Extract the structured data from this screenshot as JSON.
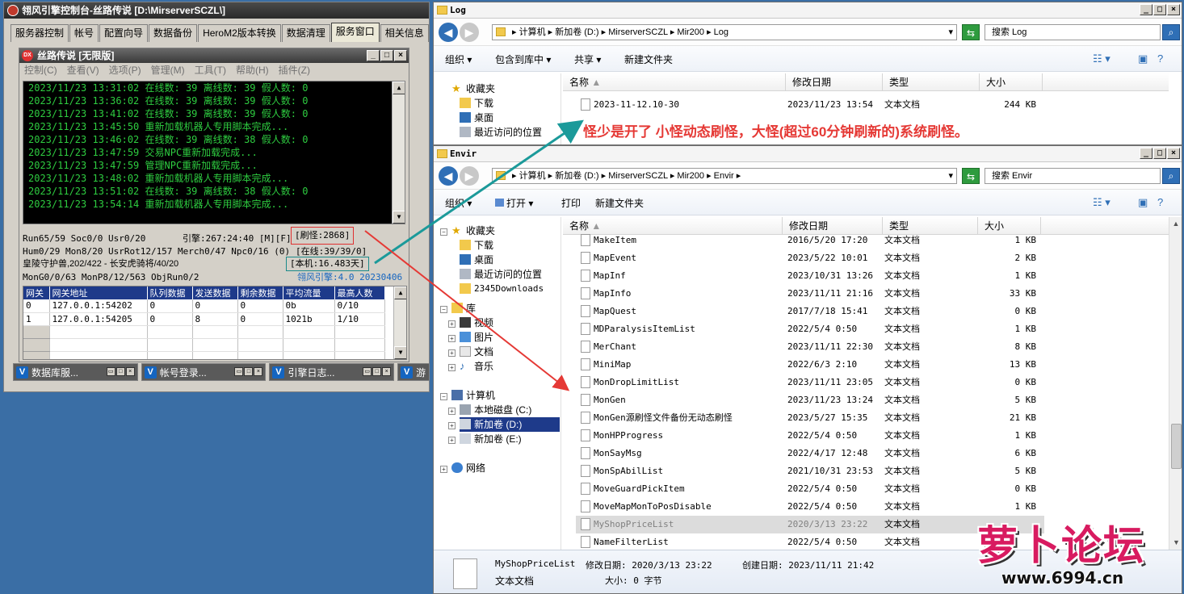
{
  "engine": {
    "title": "翎风引擎控制台-丝路传说 [D:\\MirserverSCZL\\]",
    "tabs": [
      "服务器控制",
      "帐号",
      "配置向导",
      "数据备份",
      "HeroM2版本转换",
      "数据清理",
      "服务窗口",
      "相关信息"
    ],
    "active_tab": 6,
    "child": {
      "title": "丝路传说 [无限版]",
      "logo_text": "DX",
      "menu": [
        "控制(C)",
        "查看(V)",
        "选项(P)",
        "管理(M)",
        "工具(T)",
        "帮助(H)",
        "插件(Z)"
      ],
      "log_lines": [
        "2023/11/23 13:31:02 在线数: 39 离线数: 39 假人数: 0",
        "2023/11/23 13:36:02 在线数: 39 离线数: 39 假人数: 0",
        "2023/11/23 13:41:02 在线数: 39 离线数: 39 假人数: 0",
        "2023/11/23 13:45:50 重新加载机器人专用脚本完成...",
        "2023/11/23 13:46:02 在线数: 39 离线数: 38 假人数: 0",
        "2023/11/23 13:47:59 交易NPC重新加载完成...",
        "2023/11/23 13:47:59 管理NPC重新加载完成...",
        "2023/11/23 13:48:02 重新加载机器人专用脚本完成...",
        "2023/11/23 13:51:02 在线数: 39 离线数: 38 假人数: 0",
        "2023/11/23 13:54:14 重新加载机器人专用脚本完成..."
      ],
      "status": {
        "run": "Run65/59 Soc0/0 Usr0/20",
        "engine_time": "引擎:267:24:40 [M][F]",
        "refresh": "[刷怪:2868]",
        "hum": "Hum0/29 Mon8/20 UsrRot12/157 Merch0/47 Npc0/16 (0)",
        "online": "[在线:39/39/0]",
        "boss": "皇陵守护兽,202/422 - 长安虎骑将/40/20",
        "local": "[本机:16.483天]",
        "mon": "MonG0/0/63 MonP8/12/563 ObjRun0/2",
        "version": "翎风引擎:4.0 20230406"
      },
      "gateway": {
        "headers": [
          "网关",
          "网关地址",
          "队列数据",
          "发送数据",
          "剩余数据",
          "平均流量",
          "最高人数"
        ],
        "rows": [
          [
            "0",
            "127.0.0.1:54202",
            "0",
            "0",
            "0",
            "0b",
            "0/10"
          ],
          [
            "1",
            "127.0.0.1:54205",
            "0",
            "8",
            "0",
            "1021b",
            "1/10"
          ]
        ]
      }
    },
    "taskbar": [
      "数据库服...",
      "帐号登录...",
      "引擎日志..."
    ],
    "taskbar_partial": "游"
  },
  "log_window": {
    "title": "Log",
    "breadcrumb": "▸ 计算机 ▸ 新加卷 (D:) ▸ MirserverSCZL ▸ Mir200 ▸ Log",
    "search_placeholder": "搜索 Log",
    "toolbar": [
      "组织 ▾",
      "包含到库中 ▾",
      "共享 ▾",
      "新建文件夹"
    ],
    "nav": [
      "收藏夹",
      "下载",
      "桌面",
      "最近访问的位置"
    ],
    "columns": [
      "名称",
      "修改日期",
      "类型",
      "大小"
    ],
    "files": [
      {
        "name": "2023-11-12.10-30",
        "date": "2023/11/23 13:54",
        "type": "文本文档",
        "size": "244 KB"
      }
    ]
  },
  "annotation": "怪少是开了 小怪动态刷怪，大怪(超过60分钟刷新的)系统刷怪。",
  "envir_window": {
    "title": "Envir",
    "breadcrumb": "▸ 计算机 ▸ 新加卷 (D:) ▸ MirserverSCZL ▸ Mir200 ▸ Envir ▸",
    "search_placeholder": "搜索 Envir",
    "toolbar": [
      "组织 ▾",
      "打开 ▾",
      "打印",
      "新建文件夹"
    ],
    "nav": {
      "favorites": "收藏夹",
      "fav_items": [
        "下载",
        "桌面",
        "最近访问的位置",
        "2345Downloads"
      ],
      "libraries": "库",
      "lib_items": [
        "视频",
        "图片",
        "文档",
        "音乐"
      ],
      "computer": "计算机",
      "drives": [
        "本地磁盘 (C:)",
        "新加卷 (D:)",
        "新加卷 (E:)"
      ],
      "network": "网络"
    },
    "columns": [
      "名称",
      "修改日期",
      "类型",
      "大小"
    ],
    "files": [
      {
        "name": "MakeItem",
        "date": "2016/5/20 17:20",
        "type": "文本文档",
        "size": "1 KB"
      },
      {
        "name": "MapEvent",
        "date": "2023/5/22 10:01",
        "type": "文本文档",
        "size": "2 KB"
      },
      {
        "name": "MapInf",
        "date": "2023/10/31 13:26",
        "type": "文本文档",
        "size": "1 KB"
      },
      {
        "name": "MapInfo",
        "date": "2023/11/11 21:16",
        "type": "文本文档",
        "size": "33 KB"
      },
      {
        "name": "MapQuest",
        "date": "2017/7/18 15:41",
        "type": "文本文档",
        "size": "0 KB"
      },
      {
        "name": "MDParalysisItemList",
        "date": "2022/5/4 0:50",
        "type": "文本文档",
        "size": "1 KB"
      },
      {
        "name": "MerChant",
        "date": "2023/11/11 22:30",
        "type": "文本文档",
        "size": "8 KB"
      },
      {
        "name": "MiniMap",
        "date": "2022/6/3 2:10",
        "type": "文本文档",
        "size": "13 KB"
      },
      {
        "name": "MonDropLimitList",
        "date": "2023/11/11 23:05",
        "type": "文本文档",
        "size": "0 KB"
      },
      {
        "name": "MonGen",
        "date": "2023/11/23 13:24",
        "type": "文本文档",
        "size": "5 KB"
      },
      {
        "name": "MonGen源刷怪文件备份无动态刷怪",
        "date": "2023/5/27 15:35",
        "type": "文本文档",
        "size": "21 KB"
      },
      {
        "name": "MonHPProgress",
        "date": "2022/5/4 0:50",
        "type": "文本文档",
        "size": "1 KB"
      },
      {
        "name": "MonSayMsg",
        "date": "2022/4/17 12:48",
        "type": "文本文档",
        "size": "6 KB"
      },
      {
        "name": "MonSpAbilList",
        "date": "2021/10/31 23:53",
        "type": "文本文档",
        "size": "5 KB"
      },
      {
        "name": "MoveGuardPickItem",
        "date": "2022/5/4 0:50",
        "type": "文本文档",
        "size": "0 KB"
      },
      {
        "name": "MoveMapMonToPosDisable",
        "date": "2022/5/4 0:50",
        "type": "文本文档",
        "size": "1 KB"
      },
      {
        "name": "MyShopPriceList",
        "date": "2020/3/13 23:22",
        "type": "文本文档",
        "size": ""
      },
      {
        "name": "NameFilterList",
        "date": "2022/5/4 0:50",
        "type": "文本文档",
        "size": ""
      }
    ],
    "selected_index": 16,
    "details": {
      "name": "MyShopPriceList",
      "modified": "修改日期: 2020/3/13 23:22",
      "created": "创建日期: 2023/11/11 21:42",
      "type": "文本文档",
      "size": "大小: 0 字节"
    }
  },
  "watermark": {
    "main": "萝卜论坛",
    "url": "www.6994.cn"
  },
  "colors": {
    "annotation": "#e53935",
    "arrow_teal": "#1b9a9a",
    "arrow_red": "#e53935",
    "log_text": "#2ecc40",
    "selection": "#1e3a8a"
  }
}
